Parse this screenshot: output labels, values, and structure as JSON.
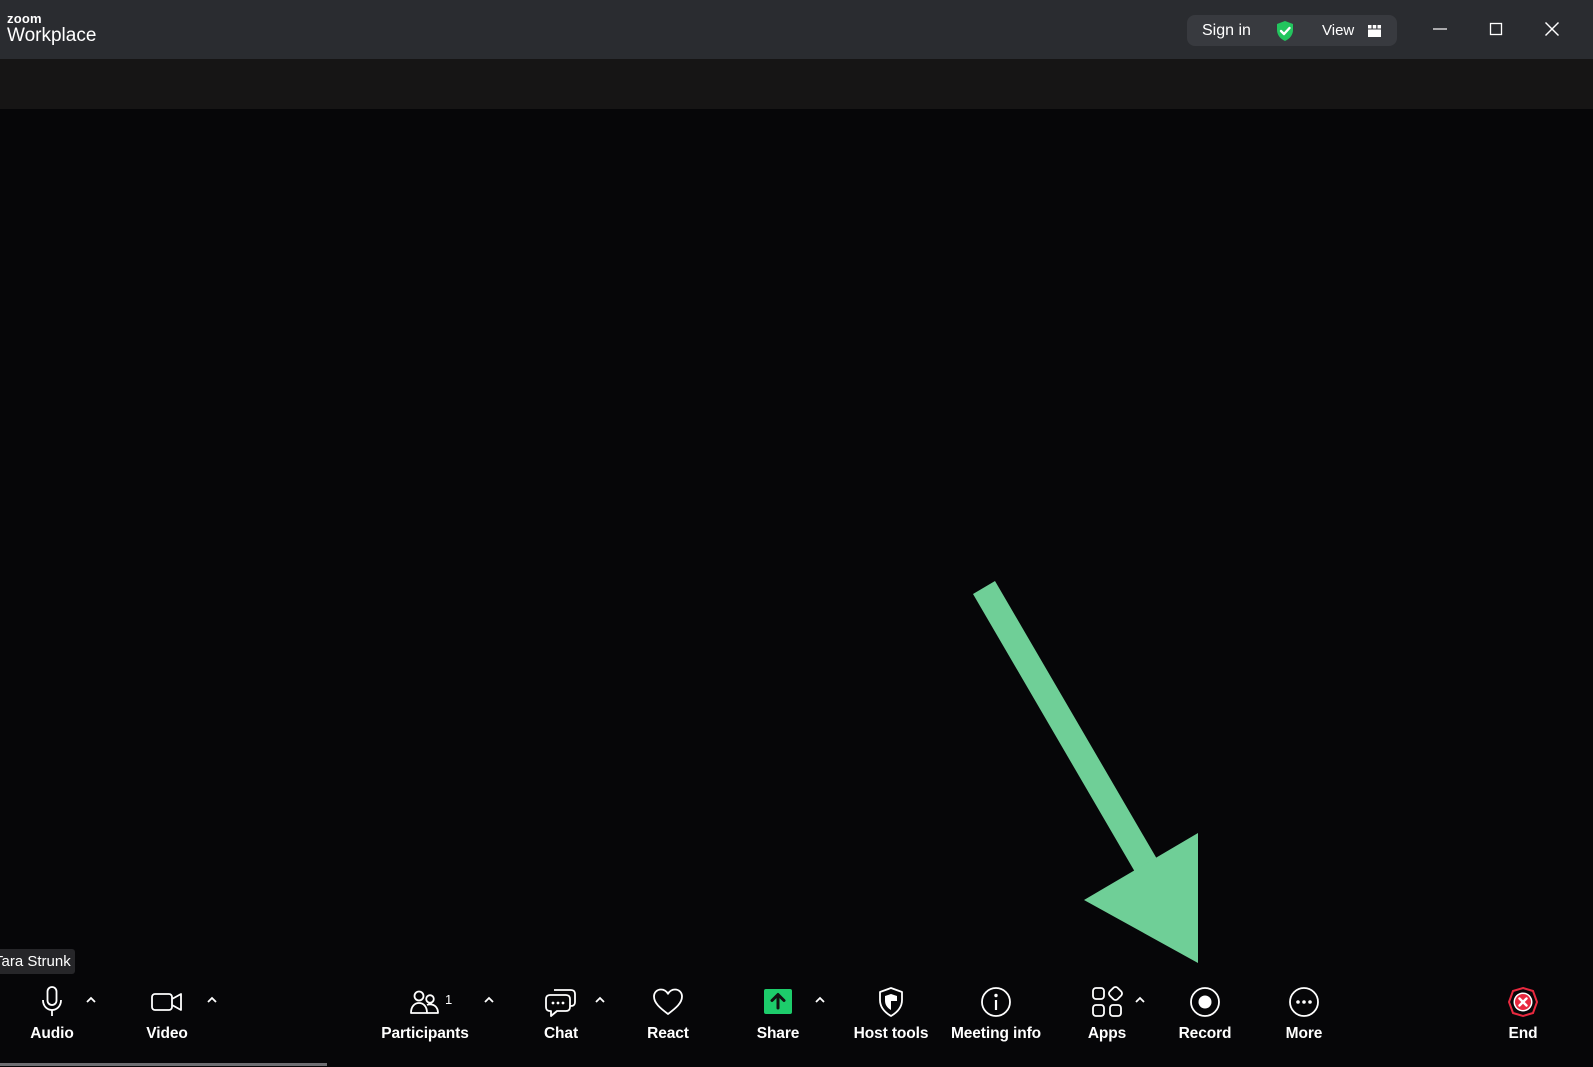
{
  "titlebar": {
    "brand_small": "zoom",
    "brand_big": "Workplace",
    "signin_label": "Sign in",
    "view_label": "View",
    "shield_color": "#23c55e",
    "window_controls": [
      "minimize-icon",
      "maximize-icon",
      "close-icon"
    ]
  },
  "video": {
    "participant_name": "Tara Strunk",
    "annotation_arrow_color": "#6fcf97"
  },
  "toolbar": {
    "audio_label": "Audio",
    "video_label": "Video",
    "participants_label": "Participants",
    "participants_count": "1",
    "chat_label": "Chat",
    "react_label": "React",
    "share_label": "Share",
    "share_color": "#1dcc6b",
    "host_tools_label": "Host tools",
    "meeting_info_label": "Meeting info",
    "apps_label": "Apps",
    "record_label": "Record",
    "more_label": "More",
    "end_label": "End",
    "end_color": "#e8293f"
  }
}
